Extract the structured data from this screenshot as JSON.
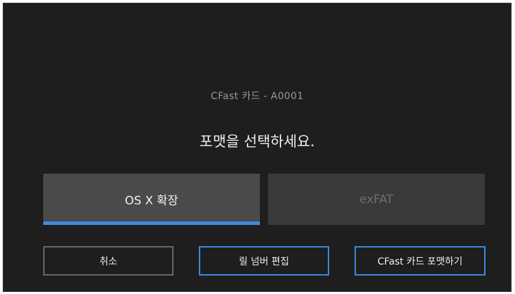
{
  "dialog": {
    "card_label": "CFast 카드 - A0001",
    "prompt": "포맷을 선택하세요."
  },
  "formats": [
    {
      "label": "OS X 확장",
      "selected": true
    },
    {
      "label": "exFAT",
      "selected": false
    }
  ],
  "buttons": {
    "cancel": "취소",
    "edit_reel": "릴 넘버 편집",
    "format_card": "CFast 카드 포맷하기"
  },
  "colors": {
    "background": "#1e1e1e",
    "accent": "#3c8be3",
    "selected_option": "#4a4a4a",
    "unselected_option": "#3a3a3a"
  }
}
